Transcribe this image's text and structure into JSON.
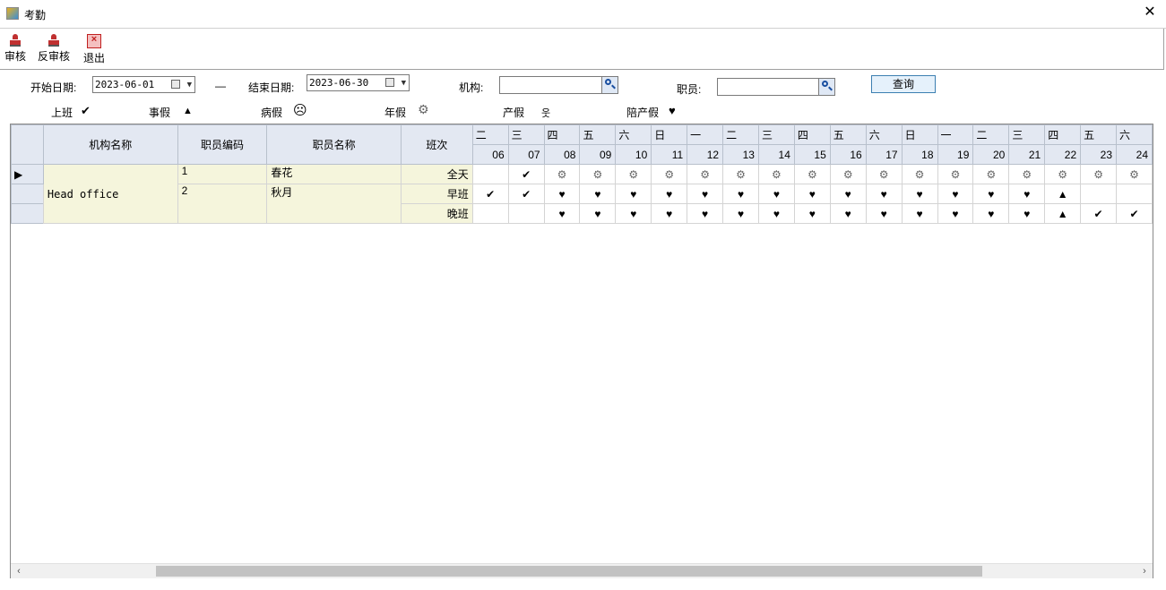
{
  "window": {
    "title": "考勤"
  },
  "toolbar": {
    "audit": "审核",
    "unaudit": "反审核",
    "exit": "退出"
  },
  "filters": {
    "start_label": "开始日期:",
    "start_value": "2023-06-01",
    "dash": "—",
    "end_label": "结束日期:",
    "end_value": "2023-06-30",
    "org_label": "机构:",
    "org_value": "",
    "staff_label": "职员:",
    "staff_value": "",
    "query_button": "查询"
  },
  "legend": [
    {
      "label": "上班",
      "symbol": "✔",
      "icon": "check-icon"
    },
    {
      "label": "事假",
      "symbol": "▲",
      "icon": "triangle-icon"
    },
    {
      "label": "病假",
      "symbol": "☹",
      "icon": "sad-face-icon"
    },
    {
      "label": "年假",
      "symbol": "⚙",
      "icon": "gear-icon"
    },
    {
      "label": "产假",
      "symbol": "웃",
      "icon": "person-icon"
    },
    {
      "label": "陪产假",
      "symbol": "♥",
      "icon": "heart-icon"
    }
  ],
  "table": {
    "headers": {
      "org": "机构名称",
      "code": "职员编码",
      "name": "职员名称",
      "shift": "班次"
    },
    "weekdays": [
      "二",
      "三",
      "四",
      "五",
      "六",
      "日",
      "一",
      "二",
      "三",
      "四",
      "五",
      "六",
      "日",
      "一",
      "二",
      "三",
      "四",
      "五",
      "六"
    ],
    "days": [
      "06",
      "07",
      "08",
      "09",
      "10",
      "11",
      "12",
      "13",
      "14",
      "15",
      "16",
      "17",
      "18",
      "19",
      "20",
      "21",
      "22",
      "23",
      "24"
    ],
    "org_name": "Head office",
    "rows": [
      {
        "code": "1",
        "name": "春花",
        "shift": "全天",
        "marks": [
          "",
          "✔",
          "⚙",
          "⚙",
          "⚙",
          "⚙",
          "⚙",
          "⚙",
          "⚙",
          "⚙",
          "⚙",
          "⚙",
          "⚙",
          "⚙",
          "⚙",
          "⚙",
          "⚙",
          "⚙",
          "⚙"
        ]
      },
      {
        "code": "2",
        "name": "秋月",
        "shift": "早班",
        "marks": [
          "✔",
          "✔",
          "♥",
          "♥",
          "♥",
          "♥",
          "♥",
          "♥",
          "♥",
          "♥",
          "♥",
          "♥",
          "♥",
          "♥",
          "♥",
          "♥",
          "▲",
          "",
          ""
        ]
      },
      {
        "code": "",
        "name": "",
        "shift": "晚班",
        "marks": [
          "",
          "",
          "♥",
          "♥",
          "♥",
          "♥",
          "♥",
          "♥",
          "♥",
          "♥",
          "♥",
          "♥",
          "♥",
          "♥",
          "♥",
          "♥",
          "▲",
          "✔",
          "✔"
        ]
      }
    ]
  }
}
